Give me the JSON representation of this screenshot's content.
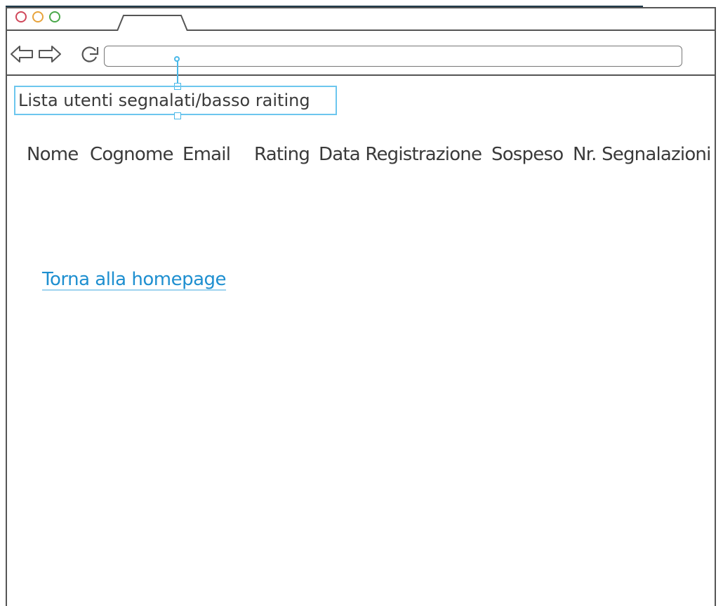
{
  "browser": {
    "address_value": ""
  },
  "page": {
    "title": "Lista utenti segnalati/basso raiting",
    "columns": [
      "Nome",
      "Cognome",
      "Email",
      "Rating",
      "Data Registrazione",
      "Sospeso",
      "Nr. Segnalazioni"
    ],
    "home_link": "Torna alla homepage"
  },
  "colors": {
    "link": "#1e8fd0",
    "selection": "#6cc6ee",
    "close_button": "#d0475a",
    "minimize_button": "#e7a33b",
    "maximize_button": "#4aa84a"
  },
  "icons": {
    "back": "arrow-left-icon",
    "forward": "arrow-right-icon",
    "reload": "reload-icon"
  }
}
